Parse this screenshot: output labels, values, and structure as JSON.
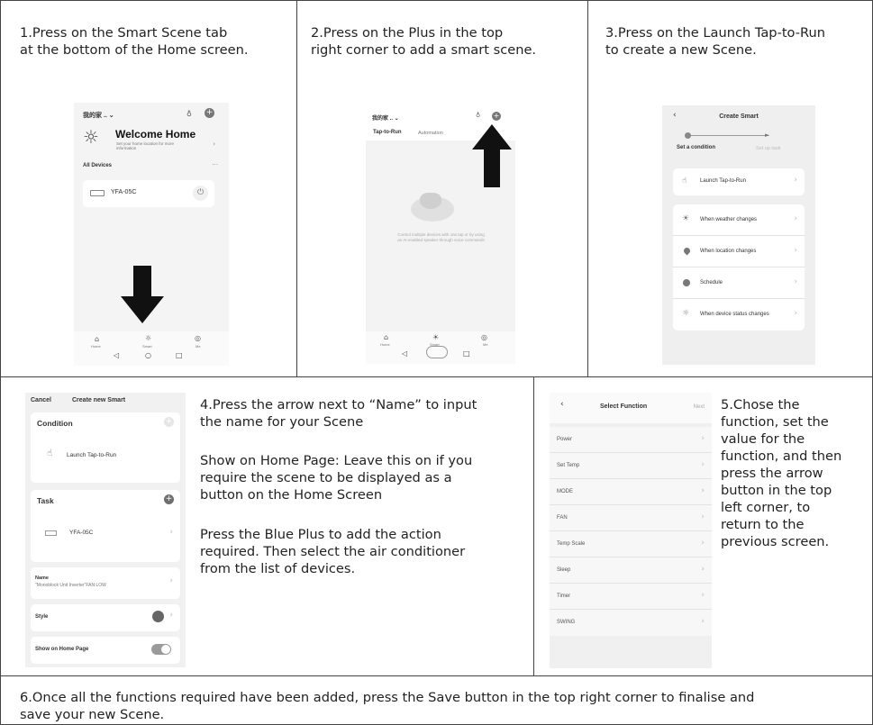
{
  "steps": {
    "s1": "1.Press on the Smart Scene tab\nat the bottom of the Home screen.",
    "s2": "2.Press on the Plus in the top\nright corner to add a smart scene.",
    "s3": "3.Press on the Launch Tap-to-Run\nto create a new Scene.",
    "s4a": "4.Press the arrow next to “Name” to input\nthe name for your Scene",
    "s4b": "Show on Home Page: Leave this on if you\nrequire the scene to be displayed as a\nbutton on the Home Screen",
    "s4c": "Press the Blue Plus to add the action\nrequired. Then select the air conditioner\nfrom the list of devices.",
    "s5": "5.Chose the\nfunction, set the\nvalue for the\nfunction, and then\npress the arrow\nbutton in the top\nleft corner, to\nreturn to the\nprevious screen.",
    "s6": "6.Once all the functions required have been added, press the Save button in the top right corner to finalise and\nsave your new Scene."
  },
  "screen1": {
    "home_label": "我的家 .. ⌄",
    "welcome": "Welcome Home",
    "welcome_sub": "Set your home location for more\ninformation",
    "all_devices": "All Devices",
    "device": "YFA-05C",
    "nav": [
      "Home",
      "Smart",
      "Me"
    ]
  },
  "screen2": {
    "home_label": "我的家 .. ⌄",
    "tab_active": "Tap-to-Run",
    "tab_inactive": "Automation",
    "empty_text": "Control multiple devices with one tap or by using\nan AI-enabled speaker through voice commands",
    "nav": [
      "Home",
      "Smart",
      "Me"
    ]
  },
  "screen3": {
    "title": "Create Smart",
    "step_a": "Set a condition",
    "step_b": "Set up task",
    "options": [
      "Launch Tap-to-Run",
      "When weather changes",
      "When location changes",
      "Schedule",
      "When device status changes"
    ]
  },
  "screen4": {
    "cancel": "Cancel",
    "title": "Create new Smart",
    "condition": "Condition",
    "launch": "Launch Tap-to-Run",
    "task": "Task",
    "device": "YFA-05C",
    "name_label": "Name",
    "name_value": "\"Monoblock Unit Inverter\"FAN:LOW",
    "style": "Style",
    "show_home": "Show on Home Page"
  },
  "screen5": {
    "title": "Select Function",
    "next": "Next",
    "functions": [
      "Power",
      "Set Temp",
      "MODE",
      "FAN",
      "Temp Scale",
      "Sleep",
      "Timer",
      "SWING"
    ]
  },
  "colors": {
    "border": "#444444",
    "arrow": "#111111",
    "toggle": "#9a9a9a"
  }
}
